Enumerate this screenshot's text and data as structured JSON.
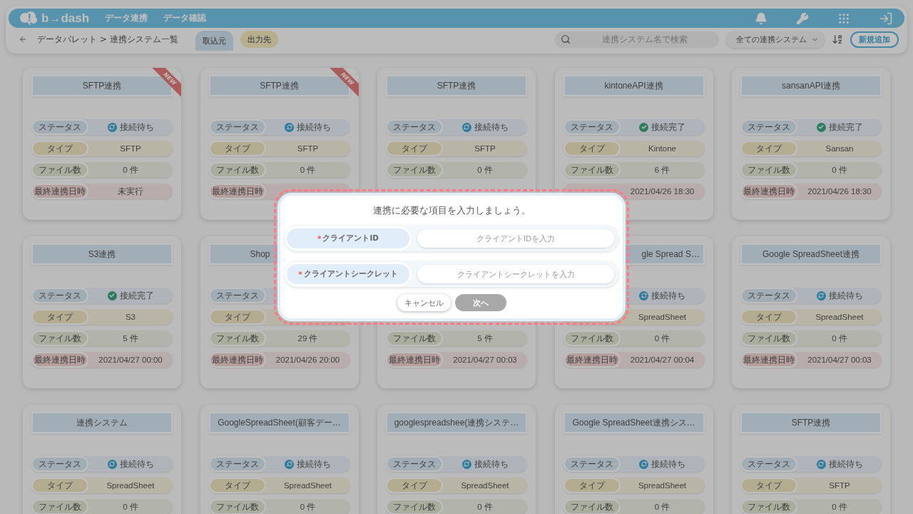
{
  "header": {
    "logo": "b→dash",
    "nav": [
      "データ連携",
      "データ確認"
    ]
  },
  "toolbar": {
    "breadcrumb": "データパレット > 連携システム一覧",
    "tabs": [
      {
        "label": "取込元",
        "selected": true
      },
      {
        "label": "出力先",
        "selected": false
      }
    ],
    "search": {
      "placeholder": "連携システム名で検索"
    },
    "filter": "全ての連携システム",
    "add_button": "新規追加"
  },
  "cards": [
    {
      "title": "SFTP連携",
      "badge": "NEW",
      "rows": [
        {
          "kind": "waiting",
          "label": "ステータス",
          "value": "接続待ち"
        },
        {
          "kind": "type",
          "label": "タイプ",
          "value": "SFTP"
        },
        {
          "kind": "files",
          "label": "ファイル数",
          "value": "0 件"
        },
        {
          "kind": "date",
          "label": "最終連携日時",
          "value": "未実行"
        }
      ]
    },
    {
      "title": "SFTP連携",
      "badge": "NEW",
      "rows": [
        {
          "kind": "waiting",
          "label": "ステータス",
          "value": "接続待ち"
        },
        {
          "kind": "type",
          "label": "タイプ",
          "value": "SFTP"
        },
        {
          "kind": "files",
          "label": "ファイル数",
          "value": "0 件"
        },
        {
          "kind": "date",
          "label": "最終連携日時"
        }
      ]
    },
    {
      "title": "SFTP連携",
      "rows": [
        {
          "kind": "waiting",
          "label": "ステータス",
          "value": "接続待ち"
        },
        {
          "kind": "type",
          "label": "タイプ",
          "value": "SFTP"
        },
        {
          "kind": "files",
          "label": "ファイル数",
          "value": "0 件"
        }
      ]
    },
    {
      "title": "kintoneAPI連携",
      "rows": [
        {
          "kind": "connected",
          "label": "ステータス",
          "value": "接続完了"
        },
        {
          "kind": "type",
          "label": "タイプ",
          "value": "Kintone"
        },
        {
          "kind": "files",
          "label": "ファイル数",
          "value": "6 件"
        },
        {
          "kind": "date",
          "value": "2021/04/26 18:30"
        }
      ]
    },
    {
      "title": "sansanAPI連携",
      "rows": [
        {
          "kind": "connected",
          "label": "ステータス",
          "value": "接続完了"
        },
        {
          "kind": "type",
          "label": "タイプ",
          "value": "Sansan"
        },
        {
          "kind": "files",
          "label": "ファイル数",
          "value": "0 件"
        },
        {
          "kind": "date",
          "label": "最終連携日時",
          "value": "2021/04/26 18:30"
        }
      ]
    },
    {
      "title": "S3連携",
      "rows": [
        {
          "kind": "connected",
          "label": "ステータス",
          "value": "接続完了"
        },
        {
          "kind": "type",
          "label": "タイプ",
          "value": "S3"
        },
        {
          "kind": "files",
          "label": "ファイル数",
          "value": "5 件"
        },
        {
          "kind": "date",
          "label": "最終連携日時",
          "value": "2021/04/27 00:00"
        }
      ]
    },
    {
      "title": "Shop",
      "kind": "rightcovered",
      "rows": [
        {
          "kind": "waiting",
          "label": "ステータス"
        },
        {
          "kind": "type",
          "label": "タイプ"
        },
        {
          "kind": "files",
          "label": "ファイル数",
          "value": "29 件"
        },
        {
          "kind": "date",
          "label": "最終連携日時",
          "value": "2021/04/26 20:00"
        }
      ]
    },
    {
      "rows": [
        {
          "kind": "files",
          "label": "ファイル数",
          "value": "5 件"
        },
        {
          "kind": "date",
          "label": "最終連携日時",
          "value": "2021/04/27 00:03"
        }
      ]
    },
    {
      "title": "gle Spread S…",
      "kind": "leftcovered",
      "rows": [
        {
          "kind": "waiting",
          "value": "接続待ち"
        },
        {
          "kind": "type",
          "value": "SpreadSheet"
        },
        {
          "kind": "files",
          "label": "ファイル数",
          "value": "0 件"
        },
        {
          "kind": "date",
          "label": "最終連携日時",
          "value": "2021/04/27 00:04"
        }
      ]
    },
    {
      "title": "Google SpreadSheet連携",
      "rows": [
        {
          "kind": "waiting",
          "label": "ステータス",
          "value": "接続待ち"
        },
        {
          "kind": "type",
          "label": "タイプ",
          "value": "SpreadSheet"
        },
        {
          "kind": "files",
          "label": "ファイル数",
          "value": "0 件"
        },
        {
          "kind": "date",
          "label": "最終連携日時",
          "value": "2021/04/27 00:03"
        }
      ]
    },
    {
      "title": "連携システム",
      "rows": [
        {
          "kind": "waiting",
          "label": "ステータス",
          "value": "接続待ち"
        },
        {
          "kind": "type",
          "label": "タイプ",
          "value": "SpreadSheet"
        },
        {
          "kind": "files",
          "label": "ファイル数",
          "value": "0 件"
        }
      ]
    },
    {
      "title": "GoogleSpreadSheet(顧客デー…",
      "rows": [
        {
          "kind": "waiting",
          "label": "ステータス",
          "value": "接続待ち"
        },
        {
          "kind": "type",
          "label": "タイプ",
          "value": "SpreadSheet"
        },
        {
          "kind": "files",
          "label": "ファイル数",
          "value": "0 件"
        }
      ]
    },
    {
      "title": "googlespreadshee(連携システ…",
      "rows": [
        {
          "kind": "waiting",
          "label": "ステータス",
          "value": "接続待ち"
        },
        {
          "kind": "type",
          "label": "タイプ",
          "value": "SpreadSheet"
        },
        {
          "kind": "files",
          "label": "ファイル数",
          "value": "0 件"
        }
      ]
    },
    {
      "title": "Google SpreadSheet連携シス…",
      "rows": [
        {
          "kind": "waiting",
          "label": "ステータス",
          "value": "接続待ち"
        },
        {
          "kind": "type",
          "label": "タイプ",
          "value": "SpreadSheet"
        },
        {
          "kind": "files",
          "label": "ファイル数",
          "value": "0 件"
        }
      ]
    },
    {
      "title": "SFTP連携",
      "rows": [
        {
          "kind": "waiting",
          "label": "ステータス",
          "value": "接続待ち"
        },
        {
          "kind": "type",
          "label": "タイプ",
          "value": "SFTP"
        },
        {
          "kind": "files",
          "label": "ファイル数",
          "value": "0 件"
        }
      ]
    }
  ],
  "dialog": {
    "title": "連携に必要な項目を入力しましょう。",
    "fields": [
      {
        "mark": "*",
        "label": "クライアントID",
        "placeholder": "クライアントIDを入力"
      },
      {
        "mark": "*",
        "label": "クライアントシークレット",
        "placeholder": "クライアントシークレットを入力"
      }
    ],
    "buttons": [
      {
        "label": "キャンセル",
        "disabled": false
      },
      {
        "label": "次へ",
        "disabled": true
      }
    ]
  }
}
